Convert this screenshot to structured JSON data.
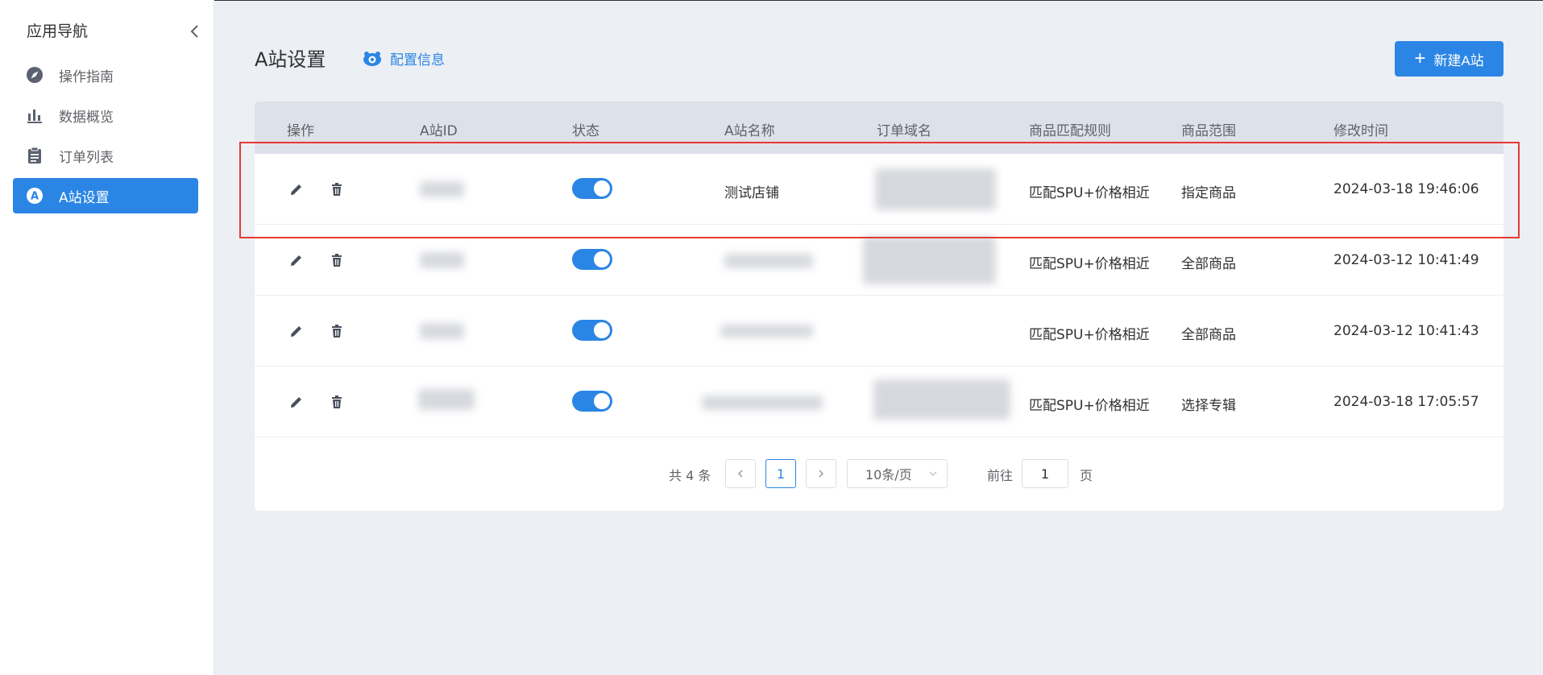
{
  "sidebar": {
    "title": "应用导航",
    "items": [
      {
        "label": "操作指南",
        "icon": "navigation-icon"
      },
      {
        "label": "数据概览",
        "icon": "bar-chart-icon"
      },
      {
        "label": "订单列表",
        "icon": "clipboard-icon"
      },
      {
        "label": "A站设置",
        "icon": "a-circle-icon",
        "active": true
      }
    ]
  },
  "header": {
    "title": "A站设置",
    "config_link": "配置信息",
    "new_button": "新建A站"
  },
  "table": {
    "columns": [
      "操作",
      "A站ID",
      "状态",
      "A站名称",
      "订单域名",
      "商品匹配规则",
      "商品范围",
      "修改时间"
    ],
    "rows": [
      {
        "name": "测试店铺",
        "rule": "匹配SPU+价格相近",
        "scope": "指定商品",
        "time": "2024-03-18 19:46:06",
        "enabled": true
      },
      {
        "name": "",
        "rule": "匹配SPU+价格相近",
        "scope": "全部商品",
        "time": "2024-03-12 10:41:49",
        "enabled": true
      },
      {
        "name": "",
        "rule": "匹配SPU+价格相近",
        "scope": "全部商品",
        "time": "2024-03-12 10:41:43",
        "enabled": true
      },
      {
        "name": "",
        "rule": "匹配SPU+价格相近",
        "scope": "选择专辑",
        "time": "2024-03-18 17:05:57",
        "enabled": true
      }
    ]
  },
  "pagination": {
    "total": "共 4 条",
    "current": "1",
    "page_size": "10条/页",
    "goto_label": "前往",
    "goto_value": "1",
    "page_suffix": "页"
  },
  "colors": {
    "accent": "#2b85e4",
    "highlight": "#e53935"
  }
}
